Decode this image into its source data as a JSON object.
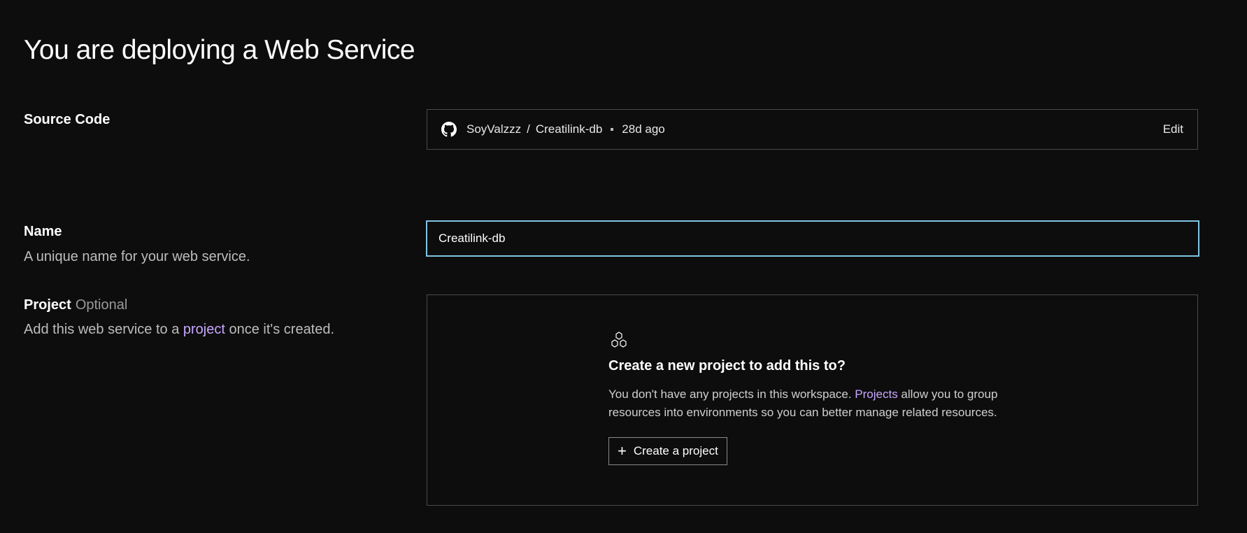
{
  "page": {
    "title": "You are deploying a Web Service"
  },
  "source_code": {
    "label": "Source Code",
    "repo_owner": "SoyValzzz",
    "separator": "/",
    "repo_name": "Creatilink-db",
    "age": "28d ago",
    "edit_label": "Edit",
    "icon": "github-icon"
  },
  "name": {
    "label": "Name",
    "description": "A unique name for your web service.",
    "input_value": "Creatilink-db",
    "focus_color": "#7fc4e2"
  },
  "project": {
    "label": "Project",
    "optional_label": "Optional",
    "description_before": "Add this web service to a ",
    "description_link": "project",
    "description_after": " once it's created.",
    "empty_icon": "hexagons-icon",
    "empty_heading": "Create a new project to add this to?",
    "empty_text_before": "You don't have any projects in this workspace. ",
    "empty_text_link": "Projects",
    "empty_text_after": " allow you to group resources into environments so you can better manage related resources.",
    "create_button_label": "Create a project",
    "link_color": "#c8a7ff"
  }
}
